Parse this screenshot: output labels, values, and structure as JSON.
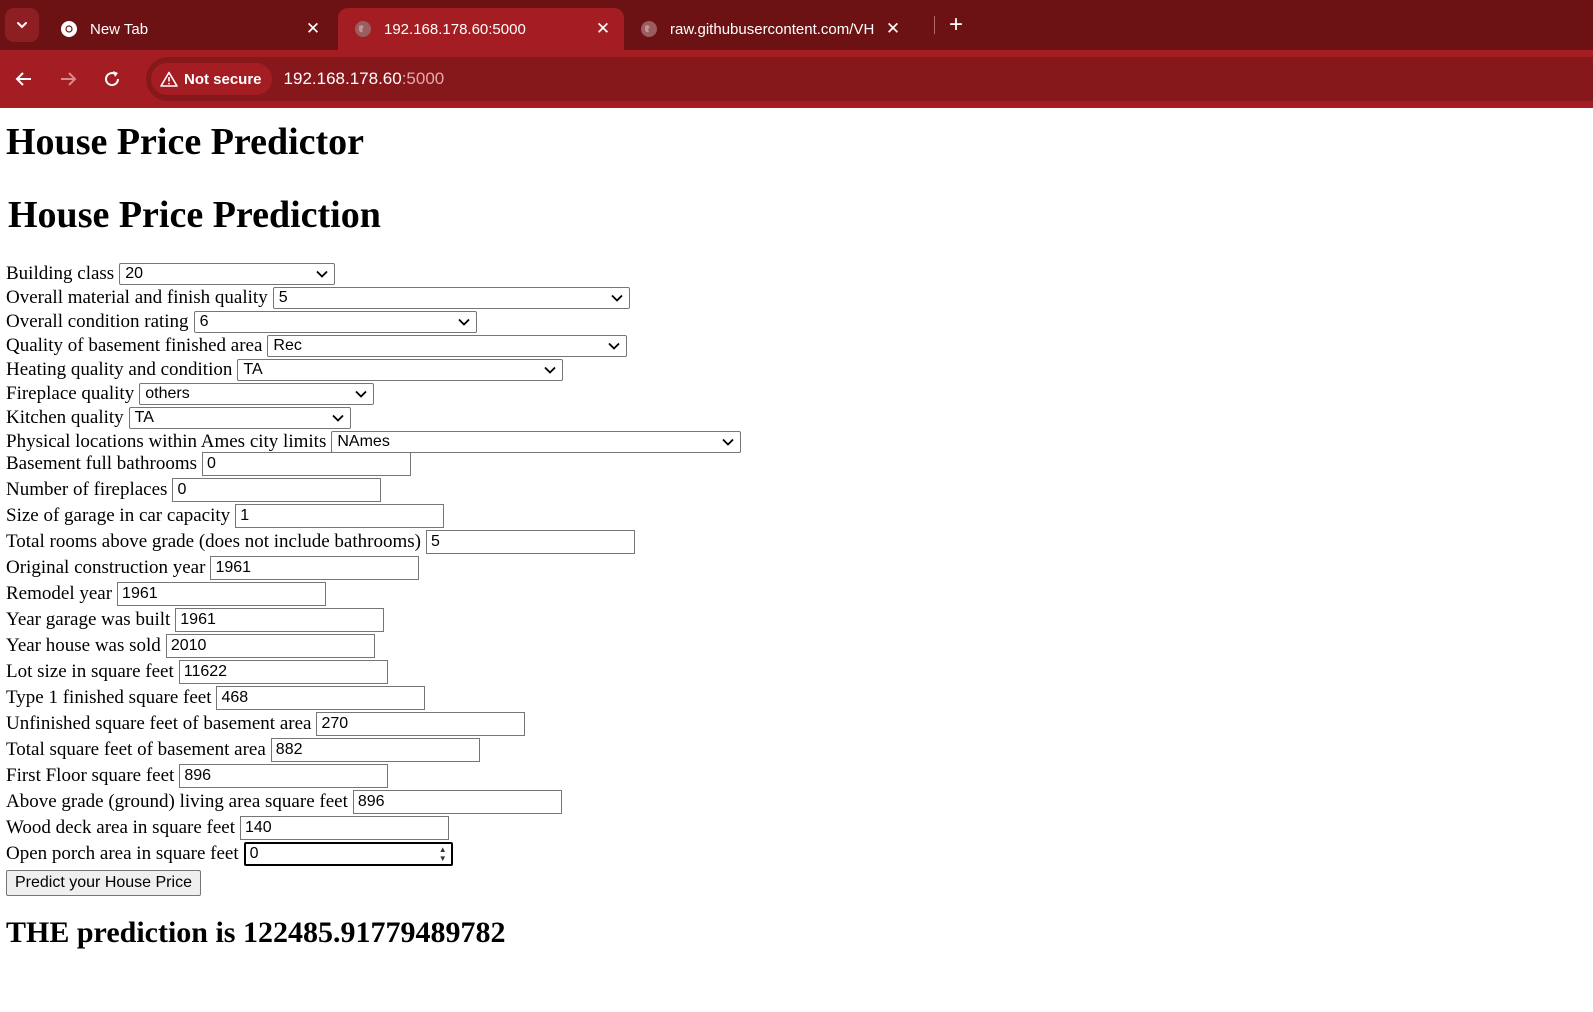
{
  "browser": {
    "tabs": [
      {
        "title": "New Tab",
        "icon": "chrome-icon",
        "active": false
      },
      {
        "title": "192.168.178.60:5000",
        "icon": "globe-icon",
        "active": true
      },
      {
        "title": "raw.githubusercontent.com/VH",
        "icon": "globe-icon",
        "active": false
      }
    ],
    "security_label": "Not secure",
    "url_host": "192.168.178.60",
    "url_port": ":5000",
    "colors": {
      "tabbar": "#6d1214",
      "toolbar": "#a31d22",
      "omnibox": "#86181c"
    }
  },
  "page": {
    "app_title": "House Price Predictor",
    "form_title": "House Price Prediction",
    "selects": [
      {
        "label": "Building class",
        "value": "20"
      },
      {
        "label": "Overall material and finish quality",
        "value": "5"
      },
      {
        "label": "Overall condition rating",
        "value": "6"
      },
      {
        "label": "Quality of basement finished area",
        "value": "Rec"
      },
      {
        "label": "Heating quality and condition",
        "value": "TA"
      },
      {
        "label": "Fireplace quality",
        "value": "others"
      },
      {
        "label": "Kitchen quality",
        "value": "TA"
      },
      {
        "label": "Physical locations within Ames city limits",
        "value": "NAmes"
      }
    ],
    "inputs": [
      {
        "label": "Basement full bathrooms",
        "value": "0"
      },
      {
        "label": "Number of fireplaces",
        "value": "0"
      },
      {
        "label": "Size of garage in car capacity",
        "value": "1"
      },
      {
        "label": "Total rooms above grade (does not include bathrooms)",
        "value": "5"
      },
      {
        "label": "Original construction year",
        "value": "1961"
      },
      {
        "label": "Remodel year",
        "value": "1961"
      },
      {
        "label": "Year garage was built",
        "value": "1961"
      },
      {
        "label": "Year house was sold",
        "value": "2010"
      },
      {
        "label": "Lot size in square feet",
        "value": "11622"
      },
      {
        "label": "Type 1 finished square feet",
        "value": "468"
      },
      {
        "label": "Unfinished square feet of basement area",
        "value": "270"
      },
      {
        "label": "Total square feet of basement area",
        "value": "882"
      },
      {
        "label": "First Floor square feet",
        "value": "896"
      },
      {
        "label": "Above grade (ground) living area square feet",
        "value": "896"
      },
      {
        "label": "Wood deck area in square feet",
        "value": "140"
      },
      {
        "label": "Open porch area in square feet",
        "value": "0"
      }
    ],
    "submit_label": "Predict your House Price",
    "result_text": "THE prediction is 122485.91779489782"
  }
}
